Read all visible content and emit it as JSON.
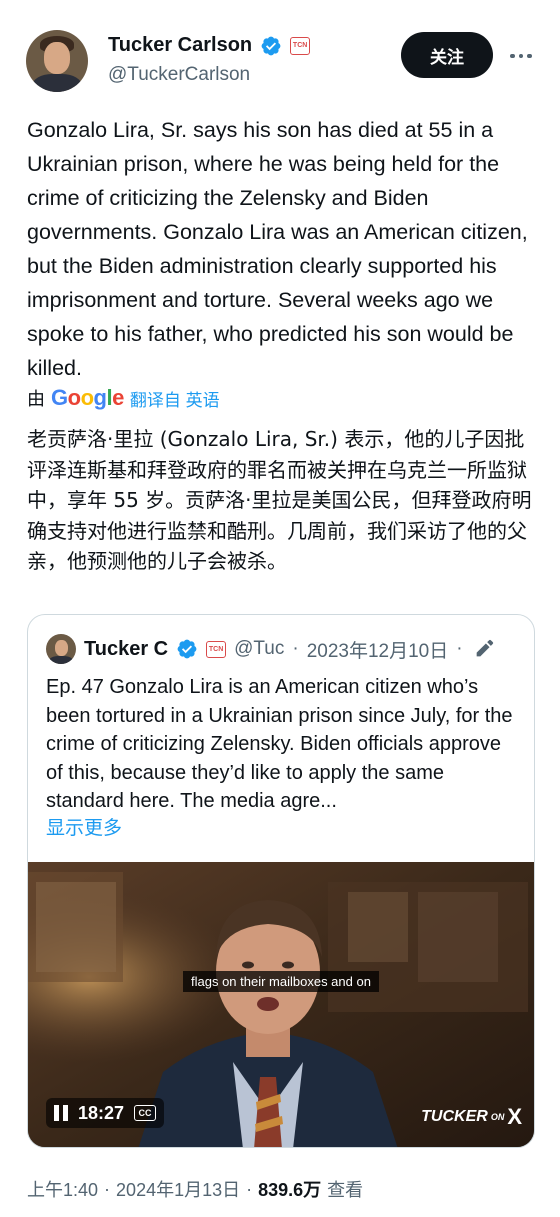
{
  "author": {
    "name": "Tucker Carlson",
    "handle": "@TuckerCarlson",
    "badge": "TCN"
  },
  "actions": {
    "follow_label": "关注"
  },
  "tweet": {
    "text": "Gonzalo Lira, Sr. says his son has died at 55 in a Ukrainian prison, where he was being held for the crime of criticizing the Zelensky and Biden governments. Gonzalo Lira was an American citizen, but the Biden administration clearly supported his imprisonment and torture. Several weeks ago we spoke to his father, who predicted his son would be killed.",
    "translation_by": "由",
    "translation_provider": "Google",
    "translation_link": "翻译自 英语",
    "translated_text": "老贡萨洛·里拉 (Gonzalo Lira, Sr.) 表示，他的儿子因批评泽连斯基和拜登政府的罪名而被关押在乌克兰一所监狱中，享年 55 岁。贡萨洛·里拉是美国公民，但拜登政府明确支持对他进行监禁和酷刑。几周前，我们采访了他的父亲，他预测他的儿子会被杀。"
  },
  "quoted": {
    "name": "Tucker C",
    "badge": "TCN",
    "handle": "@Tuc",
    "separator": "·",
    "date": "2023年12月10日",
    "text": "Ep. 47  Gonzalo Lira is an American citizen who’s been tortured in a Ukrainian prison since July, for the crime of criticizing Zelensky. Biden officials approve of this, because they’d like to apply the same standard here. The media agre...",
    "show_more": "显示更多",
    "video": {
      "caption": "flags on their mailboxes and on",
      "time": "18:27",
      "cc": "CC",
      "watermark": "TUCKER",
      "watermark_on": "ON",
      "watermark_x": "X"
    }
  },
  "footer": {
    "time": "上午1:40",
    "sep1": "·",
    "date": "2024年1月13日",
    "sep2": "·",
    "views": "839.6万",
    "views_label": "查看"
  },
  "colors": {
    "text": "#0f1419",
    "secondary": "#536471",
    "link": "#1d9bf0",
    "verified": "#1d9bf0",
    "button_bg": "#0f1419"
  }
}
